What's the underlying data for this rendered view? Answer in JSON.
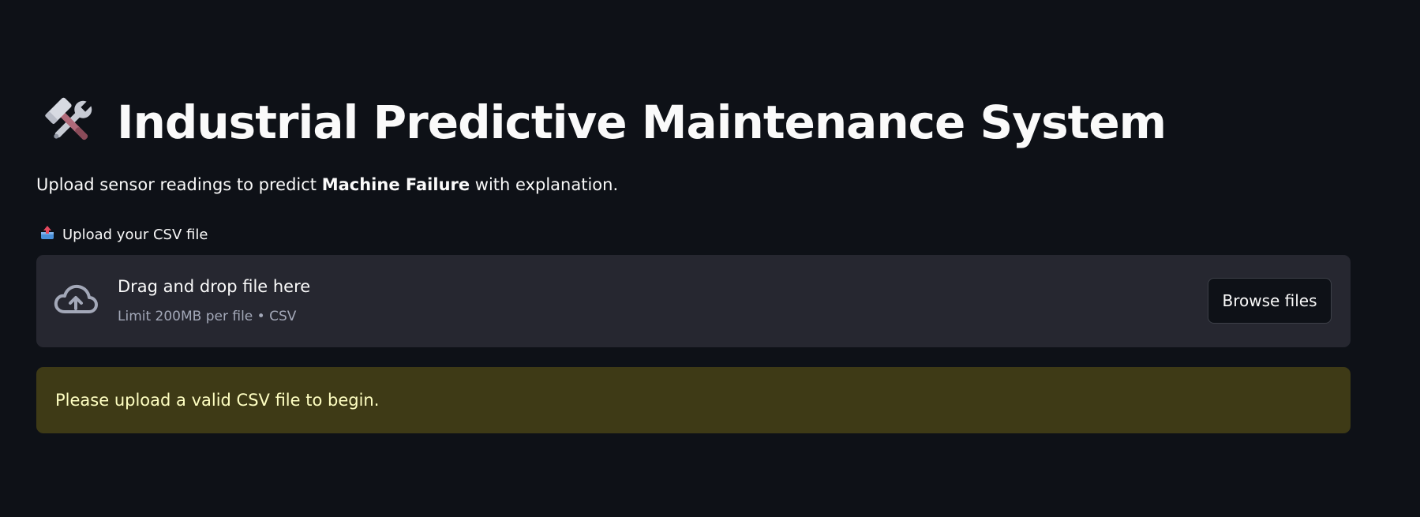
{
  "header": {
    "icon": "hammer-and-wrench-icon",
    "title": "Industrial Predictive Maintenance System"
  },
  "subtitle": {
    "prefix": "Upload sensor readings to predict ",
    "bold": "Machine Failure",
    "suffix": " with explanation."
  },
  "uploader": {
    "label_icon": "outbox-tray-icon",
    "label": "Upload your CSV file",
    "drop_icon": "cloud-upload-icon",
    "drop_text": "Drag and drop file here",
    "limit_text": "Limit 200MB per file • CSV",
    "browse_label": "Browse files"
  },
  "alert": {
    "message": "Please upload a valid CSV file to begin.",
    "color": "#3e3a16",
    "text_color": "#ffffc2"
  },
  "theme": {
    "background": "#0e1117",
    "surface": "#262730"
  }
}
